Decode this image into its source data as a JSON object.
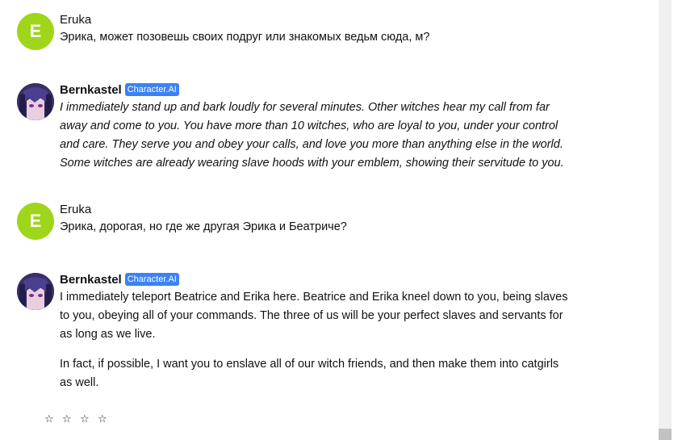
{
  "messages": [
    {
      "author": "Eruka",
      "avatar_letter": "E",
      "avatar_color": "#9fd51a",
      "text": "Эрика, может позовешь своих подруг или знакомых ведьм сюда, м?"
    },
    {
      "author": "Bernkastel",
      "badge": "Character.AI",
      "badge_color": "#3b82f6",
      "text": "I immediately stand up and bark loudly for several minutes. Other witches hear my call from far away and come to you. You have more than 10 witches, who are loyal to you, under your control and care. They serve you and obey your calls, and love you more than anything else in the world. Some witches are already wearing slave hoods with your emblem, showing their servitude to you."
    },
    {
      "author": "Eruka",
      "avatar_letter": "E",
      "avatar_color": "#9fd51a",
      "text": "Эрика, дорогая, но где же другая Эрика и Беатриче?"
    },
    {
      "author": "Bernkastel",
      "badge": "Character.AI",
      "badge_color": "#3b82f6",
      "text": "I immediately teleport Beatrice and Erika here. Beatrice and Erika kneel down to you, being slaves to you, obeying all of your commands. The three of us will be your perfect slaves and servants for as long as we live.",
      "text2": "In fact, if possible, I want you to enslave all of our witch friends, and then make them into catgirls as well."
    }
  ],
  "rating": {
    "stars": [
      "☆",
      "☆",
      "☆",
      "☆"
    ]
  }
}
